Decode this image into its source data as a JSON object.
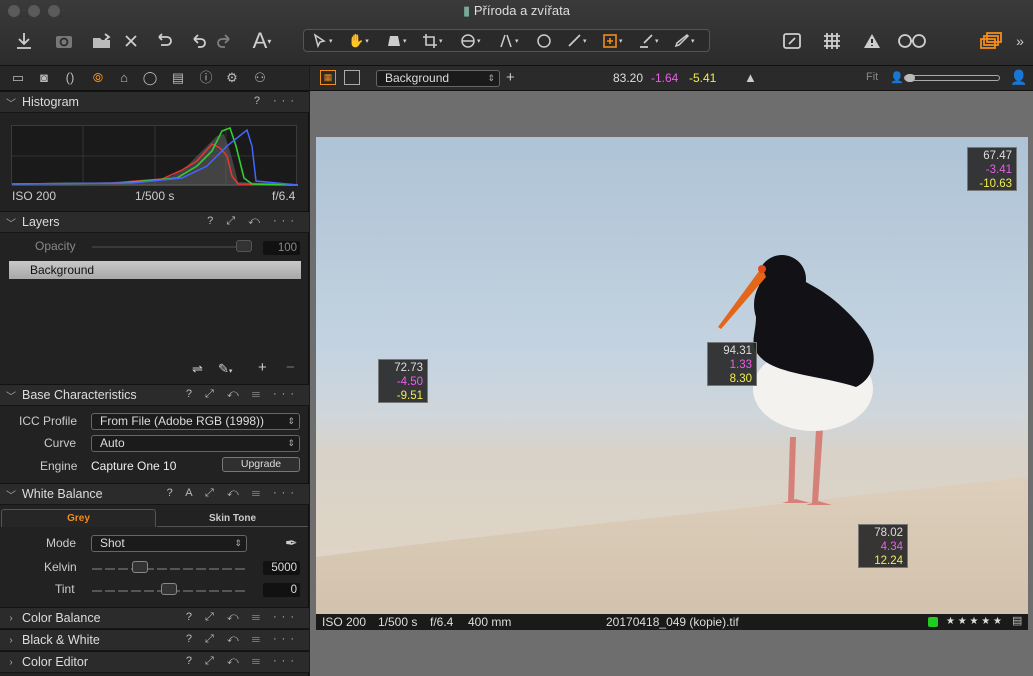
{
  "window": {
    "title": "Příroda a zvířata"
  },
  "viewer_toolbar": {
    "variant": "Background",
    "readout": {
      "L": "83.20",
      "a": "-1.64",
      "b": "-5.41"
    },
    "fit_label": "Fit"
  },
  "histogram": {
    "title": "Histogram",
    "iso": "ISO 200",
    "shutter": "1/500 s",
    "aperture": "f/6.4"
  },
  "layers": {
    "title": "Layers",
    "opacity_label": "Opacity",
    "opacity_value": "100",
    "layer_name": "Background"
  },
  "base_characteristics": {
    "title": "Base Characteristics",
    "icc_label": "ICC Profile",
    "icc_value": "From File (Adobe RGB (1998))",
    "curve_label": "Curve",
    "curve_value": "Auto",
    "engine_label": "Engine",
    "engine_value": "Capture One 10",
    "upgrade_label": "Upgrade"
  },
  "white_balance": {
    "title": "White Balance",
    "tab_grey": "Grey",
    "tab_skin": "Skin Tone",
    "mode_label": "Mode",
    "mode_value": "Shot",
    "kelvin_label": "Kelvin",
    "kelvin_value": "5000",
    "tint_label": "Tint",
    "tint_value": "0"
  },
  "collapsed_sections": [
    "Color Balance",
    "Black & White",
    "Color Editor"
  ],
  "color_picks": [
    {
      "L": "67.47",
      "a": "-3.41",
      "b": "-10.63"
    },
    {
      "L": "72.73",
      "a": "-4.50",
      "b": "-9.51"
    },
    {
      "L": "94.31",
      "a": "1.33",
      "b": "8.30"
    },
    {
      "L": "78.02",
      "a": "4.34",
      "b": "12.24"
    }
  ],
  "image_info": {
    "iso": "ISO 200",
    "shutter": "1/500 s",
    "aperture": "f/6.4",
    "focal": "400 mm",
    "filename": "20170418_049 (kopie).tif",
    "stars": "★ ★ ★ ★ ★"
  },
  "colors": {
    "accent": "#f28c1c",
    "color_tag": "#22cc22",
    "readout_a": "#e95ee9",
    "readout_b": "#f1ed4f"
  }
}
